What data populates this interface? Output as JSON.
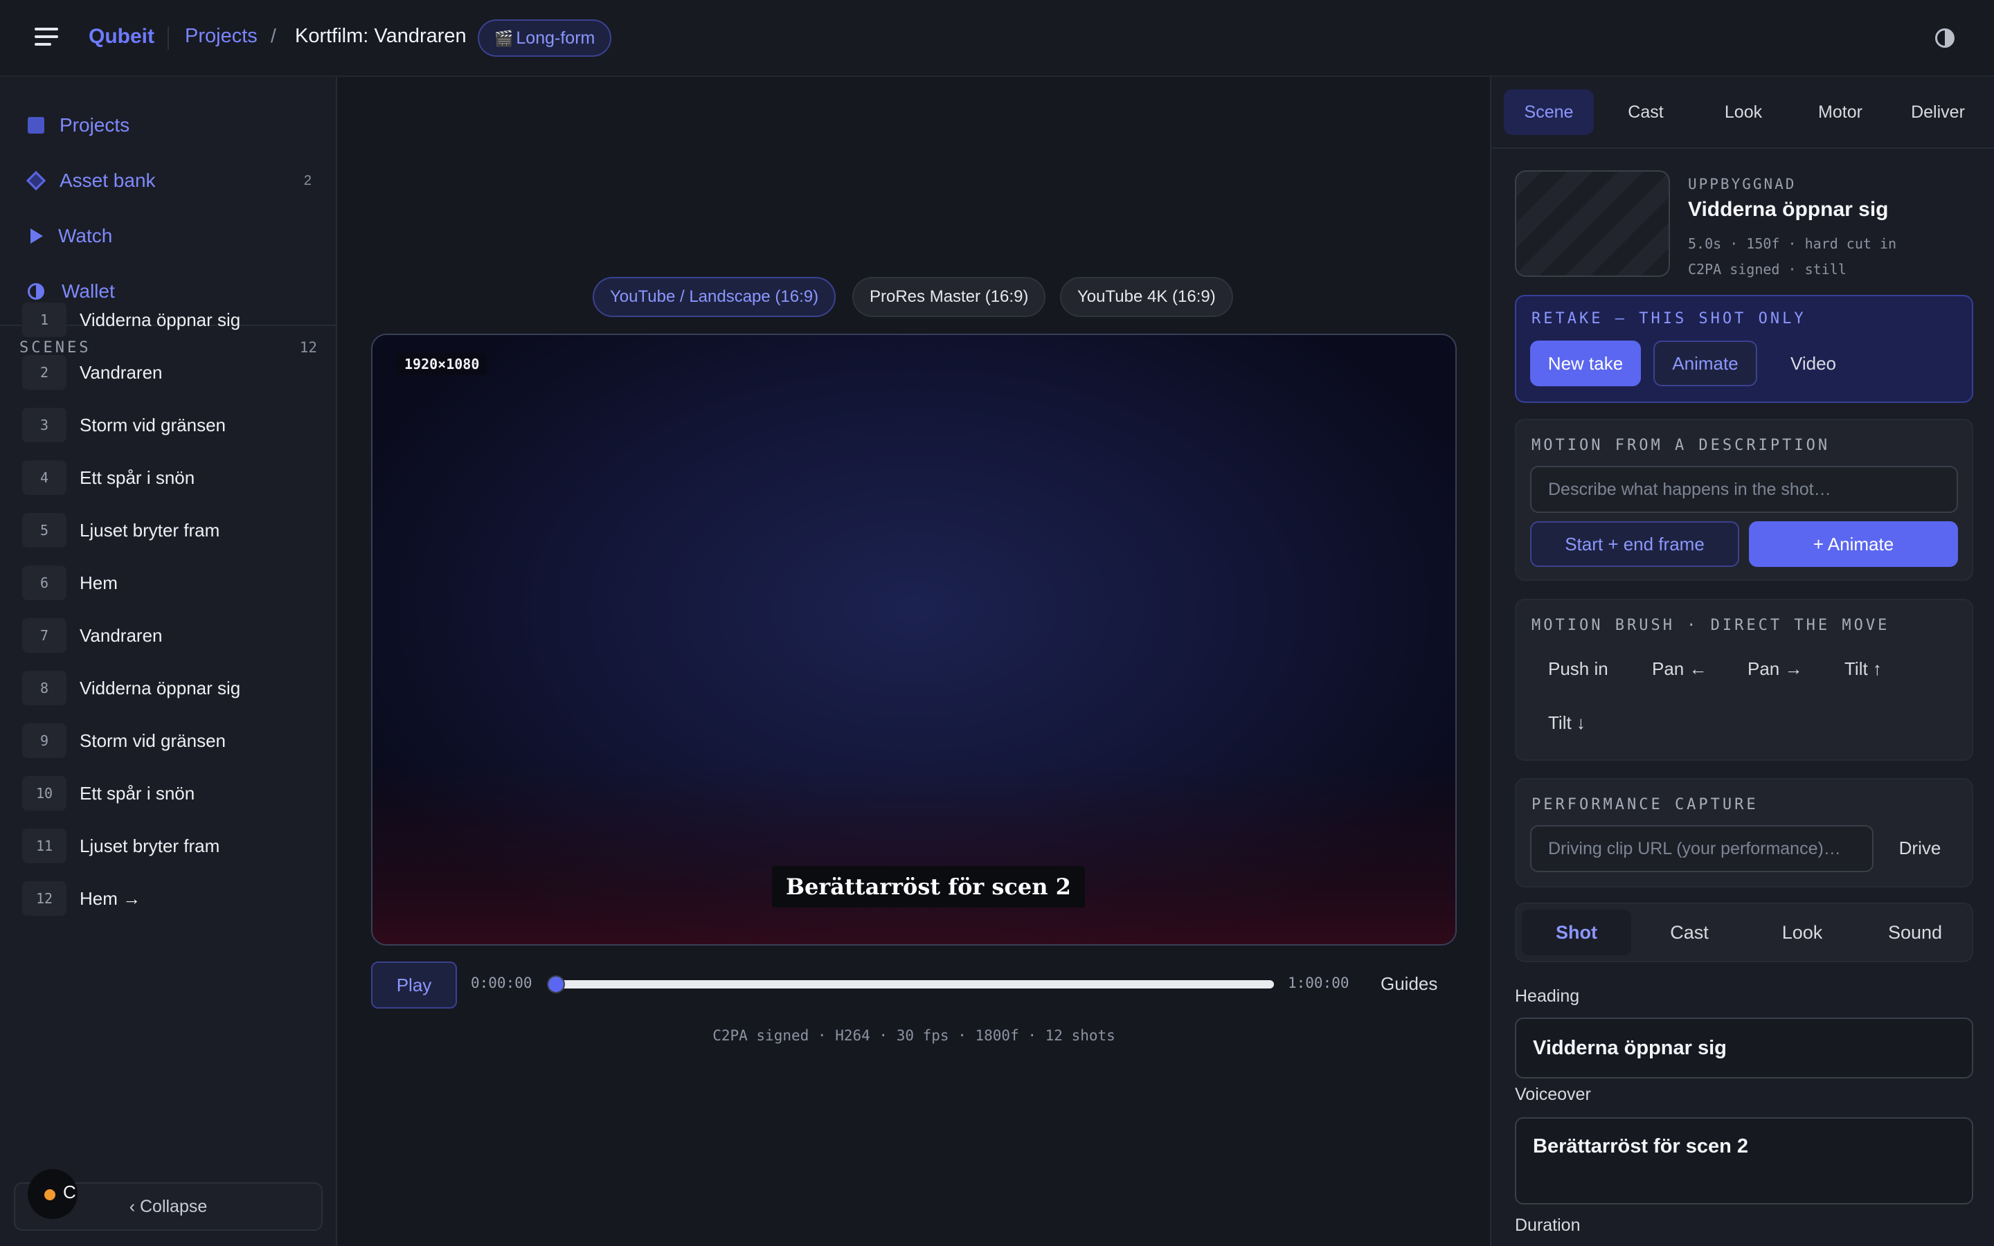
{
  "topbar": {
    "menu_icon": "hamburger-menu-icon",
    "brand": "Qubeit",
    "crumb_projects": "Projects",
    "crumb_sep": "/",
    "crumb_current": "Kortfilm: Vandraren",
    "mode_badge": "Long-form",
    "mode_badge_icon": "🎬",
    "theme_icon": "contrast-icon"
  },
  "sidebar": {
    "nav": [
      {
        "label": "Projects",
        "icon": "square-icon"
      },
      {
        "label": "Asset bank",
        "icon": "diamond-icon",
        "count": "2"
      },
      {
        "label": "Watch",
        "icon": "play-icon"
      },
      {
        "label": "Wallet",
        "icon": "half-circle-icon"
      }
    ],
    "scenes_heading": "SCENES",
    "scenes_count": "12",
    "scenes": [
      {
        "num": "1",
        "title": "Vidderna öppnar sig"
      },
      {
        "num": "2",
        "title": "Vandraren"
      },
      {
        "num": "3",
        "title": "Storm vid gränsen"
      },
      {
        "num": "4",
        "title": "Ett spår i snön"
      },
      {
        "num": "5",
        "title": "Ljuset bryter fram"
      },
      {
        "num": "6",
        "title": "Hem"
      },
      {
        "num": "7",
        "title": "Vandraren"
      },
      {
        "num": "8",
        "title": "Vidderna öppnar sig"
      },
      {
        "num": "9",
        "title": "Storm vid gränsen"
      },
      {
        "num": "10",
        "title": "Ett spår i snön"
      },
      {
        "num": "11",
        "title": "Ljuset bryter fram"
      },
      {
        "num": "12",
        "title": "Hem →"
      }
    ],
    "collapse_label": "‹ Collapse",
    "avatar_initial": "C"
  },
  "center": {
    "formats": [
      {
        "label": "YouTube / Landscape (16:9)",
        "active": true
      },
      {
        "label": "ProRes Master (16:9)",
        "active": false
      },
      {
        "label": "YouTube 4K (16:9)",
        "active": false
      }
    ],
    "resolution": "1920×1080",
    "subtitle": "Berättarröst för scen 2",
    "play_label": "Play",
    "time_start": "0:00:00",
    "time_end": "1:00:00",
    "progress": 0.0,
    "guides_label": "Guides",
    "meta": "C2PA signed · H264 · 30 fps · 1800f · 12 shots"
  },
  "right": {
    "tabs": [
      {
        "label": "Scene",
        "active": true
      },
      {
        "label": "Cast",
        "active": false
      },
      {
        "label": "Look",
        "active": false
      },
      {
        "label": "Motor",
        "active": false
      },
      {
        "label": "Deliver",
        "active": false
      }
    ],
    "shot": {
      "kicker": "UPPBYGGNAD",
      "title": "Vidderna öppnar sig",
      "meta1": "5.0s · 150f · hard cut in",
      "meta2": "C2PA signed · still"
    },
    "retake": {
      "label": "RETAKE — THIS SHOT ONLY",
      "new_take": "New take",
      "animate": "Animate",
      "video": "Video"
    },
    "motion": {
      "label": "MOTION FROM A DESCRIPTION",
      "placeholder": "Describe what happens in the shot…",
      "start_end": "Start + end frame",
      "animate": "+ Animate"
    },
    "brush": {
      "label": "MOTION BRUSH · DIRECT THE MOVE",
      "push_in": "Push in",
      "pan_left": "Pan ←",
      "pan_right": "Pan →",
      "tilt_up": "Tilt ↑",
      "tilt_down": "Tilt ↓"
    },
    "performance": {
      "label": "PERFORMANCE CAPTURE",
      "placeholder": "Driving clip URL (your performance)…",
      "drive": "Drive"
    },
    "subtabs": [
      {
        "label": "Shot",
        "active": true
      },
      {
        "label": "Cast",
        "active": false
      },
      {
        "label": "Look",
        "active": false
      },
      {
        "label": "Sound",
        "active": false
      }
    ],
    "heading_label": "Heading",
    "heading_value": "Vidderna öppnar sig",
    "voiceover_label": "Voiceover",
    "voiceover_value": "Berättarröst för scen 2",
    "duration_label": "Duration"
  },
  "colors": {
    "accent": "#5b67f0",
    "accent_text": "#8c97ff",
    "background": "#15181f",
    "panel": "#1a1d25",
    "status_dot": "#f29a2e"
  }
}
